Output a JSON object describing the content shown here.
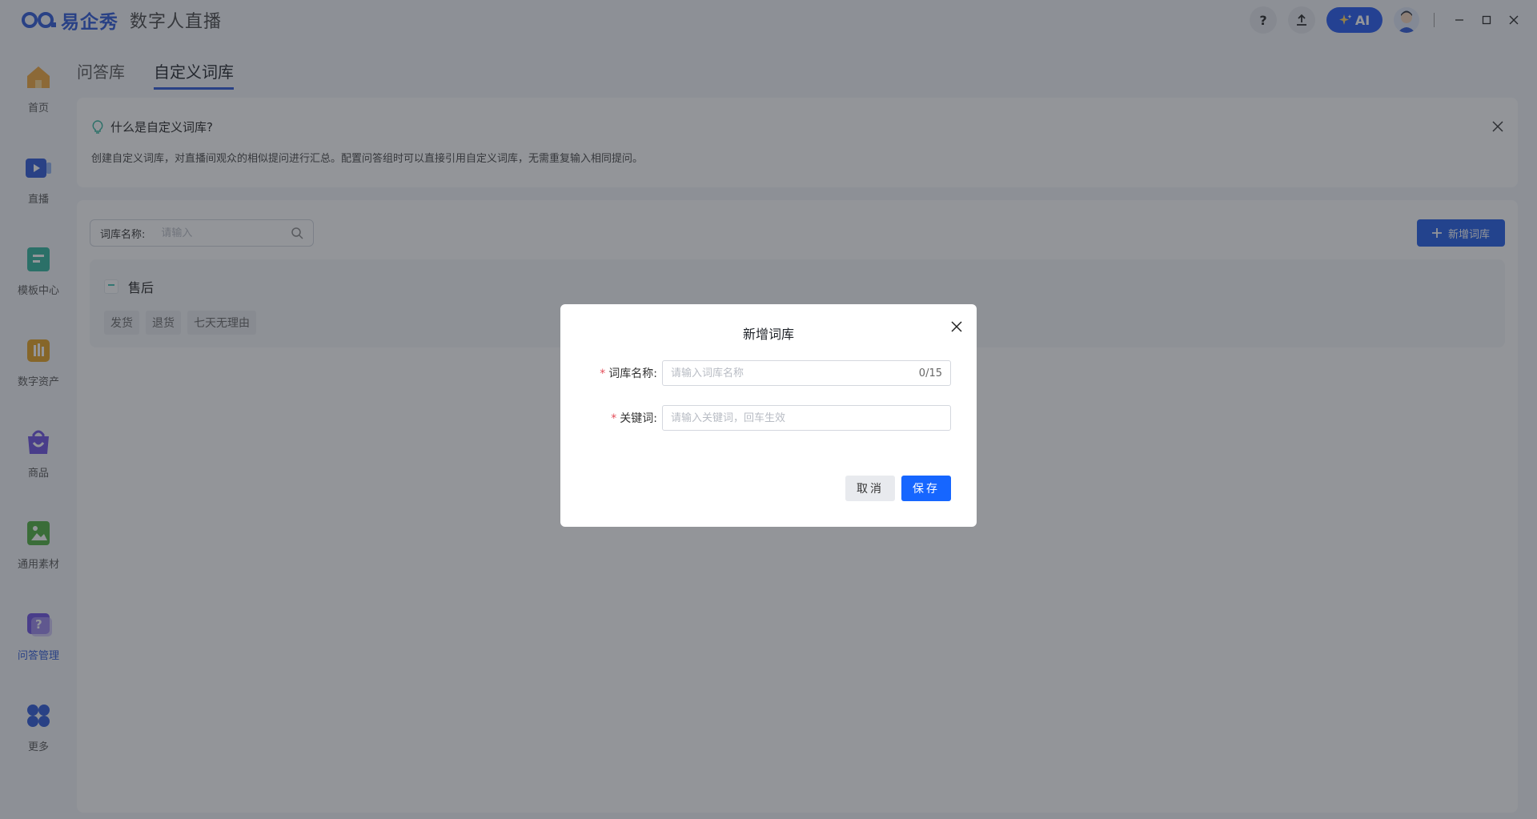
{
  "app": {
    "brand": "易企秀",
    "title": "数字人直播"
  },
  "titlebar": {
    "help_label": "?",
    "ai_label": "AI"
  },
  "sidebar": {
    "items": [
      {
        "label": "首页",
        "color": "#f0a63a"
      },
      {
        "label": "直播",
        "color": "#2a57d6"
      },
      {
        "label": "模板中心",
        "color": "#2fb59c"
      },
      {
        "label": "数字资产",
        "color": "#e5a11f"
      },
      {
        "label": "商品",
        "color": "#6a4fe0"
      },
      {
        "label": "通用素材",
        "color": "#4caf3d"
      },
      {
        "label": "问答管理",
        "color": "#6a4fe0"
      },
      {
        "label": "更多",
        "color": "#2a57d6"
      }
    ],
    "active_index": 6
  },
  "tabs": [
    {
      "label": "问答库"
    },
    {
      "label": "自定义词库"
    }
  ],
  "notice": {
    "title": "什么是自定义词库?",
    "description": "创建自定义词库，对直播间观众的相似提问进行汇总。配置问答组时可以直接引用自定义词库，无需重复输入相同提问。"
  },
  "search": {
    "label": "词库名称:",
    "placeholder": "请输入"
  },
  "add_button_label": "新增词库",
  "library": {
    "name": "售后",
    "keywords": [
      "发货",
      "退货",
      "七天无理由"
    ]
  },
  "modal": {
    "title": "新增词库",
    "name_label": "词库名称:",
    "name_placeholder": "请输入词库名称",
    "name_counter": "0/15",
    "keyword_label": "关键词:",
    "keyword_placeholder": "请输入关键词，回车生效",
    "cancel_label": "取消",
    "save_label": "保存"
  },
  "colors": {
    "primary": "#1e5ae6",
    "required": "#e34d59"
  }
}
